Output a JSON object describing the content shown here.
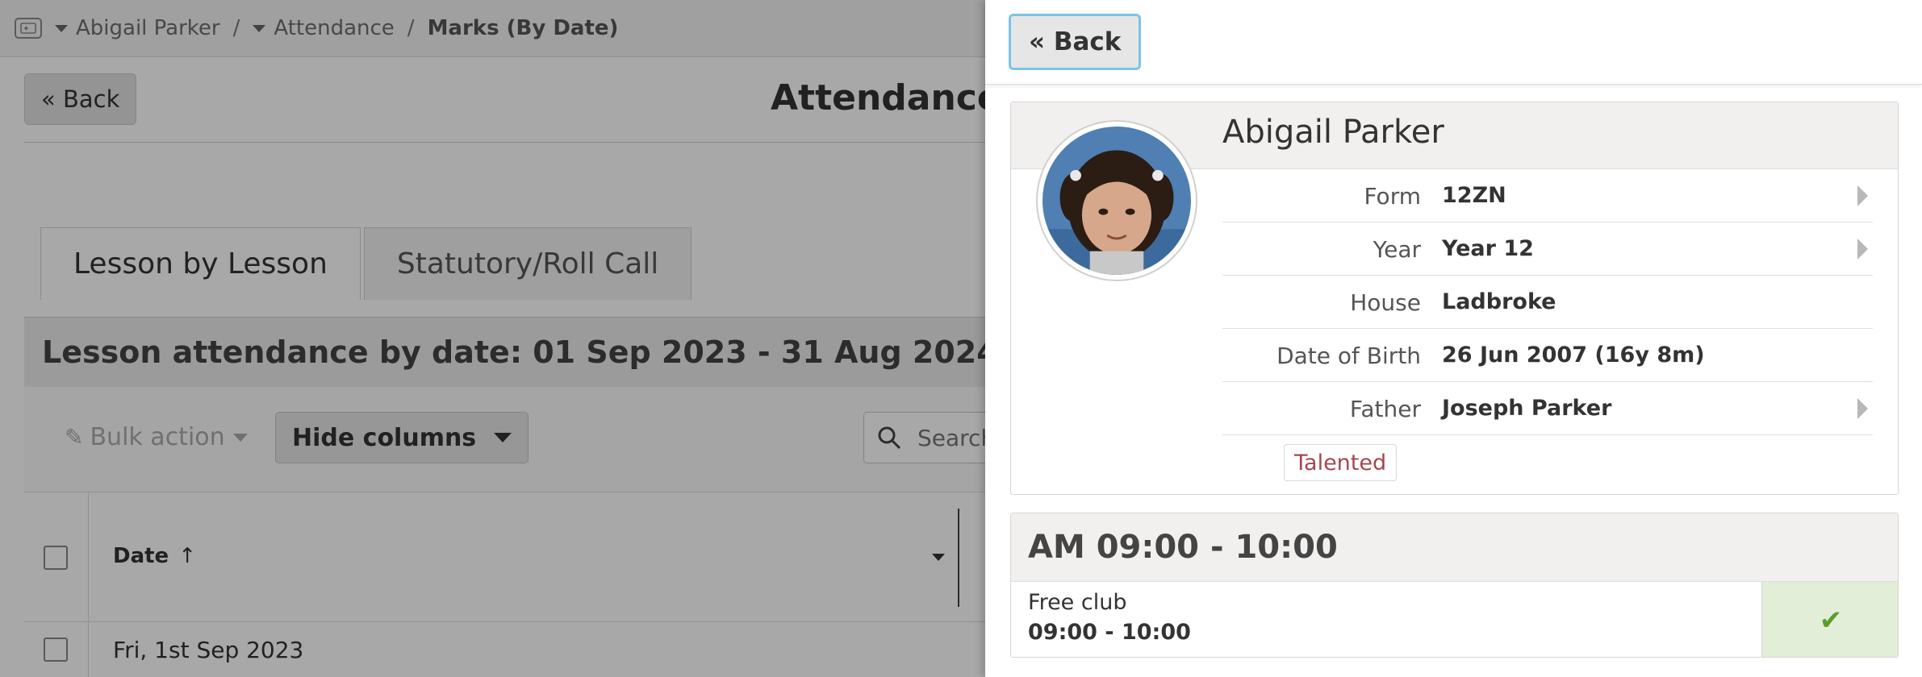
{
  "breadcrumb": {
    "items": [
      "Abigail Parker",
      "Attendance"
    ],
    "current": "Marks (By Date)",
    "separator": "/"
  },
  "background": {
    "back_label": "« Back",
    "page_title": "Attendance M",
    "tabs": [
      {
        "label": "Lesson by Lesson",
        "active": true
      },
      {
        "label": "Statutory/Roll Call",
        "active": false
      }
    ],
    "panel_title": "Lesson attendance by date: 01 Sep 2023 - 31 Aug 2024",
    "bulk_action_label": "Bulk action",
    "hide_columns_label": "Hide columns",
    "search_placeholder": "Search",
    "table": {
      "date_header": "Date",
      "sort_indicator": "↑",
      "rows": [
        {
          "date": "Fri, 1st Sep 2023"
        }
      ]
    }
  },
  "drawer": {
    "back_label": "« Back",
    "student": {
      "name": "Abigail Parker",
      "fields": [
        {
          "label": "Form",
          "value": "12ZN",
          "link": true
        },
        {
          "label": "Year",
          "value": "Year 12",
          "link": true
        },
        {
          "label": "House",
          "value": "Ladbroke",
          "link": false
        },
        {
          "label": "Date of Birth",
          "value": "26 Jun 2007 (16y 8m)",
          "link": false
        },
        {
          "label": "Father",
          "value": "Joseph Parker",
          "link": true
        }
      ],
      "tag": "Talented"
    },
    "session": {
      "title": "AM 09:00 - 10:00",
      "activity": "Free club",
      "time": "09:00 - 10:00",
      "mark_icon": "check-icon"
    }
  },
  "colors": {
    "accent_focus": "#7cc3e8",
    "tag_text": "#a3484f",
    "mark_bg": "#e2eed8",
    "mark_check": "#5c9e2c"
  }
}
